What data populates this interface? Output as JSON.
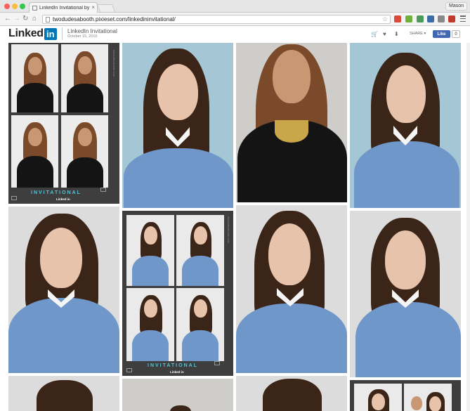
{
  "browser": {
    "tab_title": "LinkedIn Invitational by Tw",
    "profile_name": "Mason",
    "url": "twodudesabooth.pixieset.com/linkedininvitational/"
  },
  "site": {
    "logo_text": "Linked",
    "logo_badge": "in",
    "gallery_title": "LinkedIn Invitational",
    "gallery_date": "October 15, 2015",
    "share_label": "SHARE ▾",
    "like_label": "Like",
    "like_count": "0"
  },
  "strip": {
    "word": "INVITATIONAL",
    "brand": "Linked in",
    "side_text": "twodudesabooth.com"
  },
  "colors": {
    "backdrop_blue": "#a5c6d4",
    "backdrop_grey": "#cfcdc9",
    "sweater_blue": "#6f97c9",
    "linkedin_blue": "#0077b5",
    "facebook_blue": "#4267b2",
    "strip_accent": "#59c3d7"
  },
  "icons": [
    "cart-icon",
    "heart-icon",
    "download-icon",
    "star-icon",
    "menu-icon"
  ]
}
